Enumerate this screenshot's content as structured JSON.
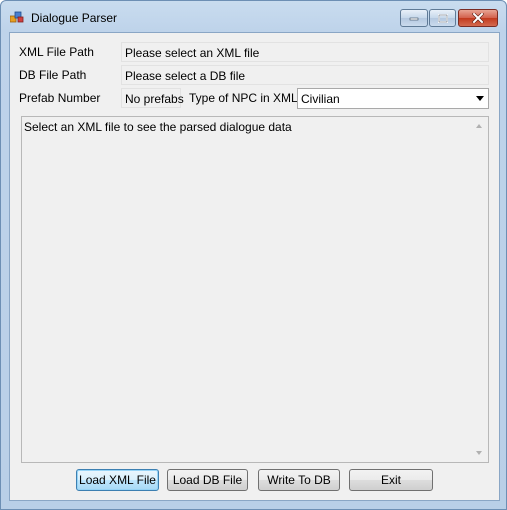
{
  "window": {
    "title": "Dialogue Parser",
    "app_icon": "dialogue-parser-app-icon",
    "controls": {
      "minimize_icon": "minimize-icon",
      "maximize_icon": "maximize-icon",
      "close_icon": "close-icon"
    }
  },
  "form": {
    "xml_file_path": {
      "label": "XML File Path",
      "value": "Please select an XML file"
    },
    "db_file_path": {
      "label": "DB File Path",
      "value": "Please select a DB file"
    },
    "prefab_number": {
      "label": "Prefab Number",
      "value": "No prefabs"
    },
    "npc_type": {
      "label": "Type of NPC in XML",
      "selected": "Civilian"
    },
    "output": {
      "text": "Select an XML file to see the parsed dialogue data"
    }
  },
  "buttons": {
    "load_xml": "Load XML File",
    "load_db": "Load DB File",
    "write_db": "Write To DB",
    "exit": "Exit"
  },
  "colors": {
    "window_frame": "#b9cfe7",
    "client_background": "#f0f0f0",
    "close_button": "#c2391d",
    "default_button_border": "#3c7fb1"
  }
}
